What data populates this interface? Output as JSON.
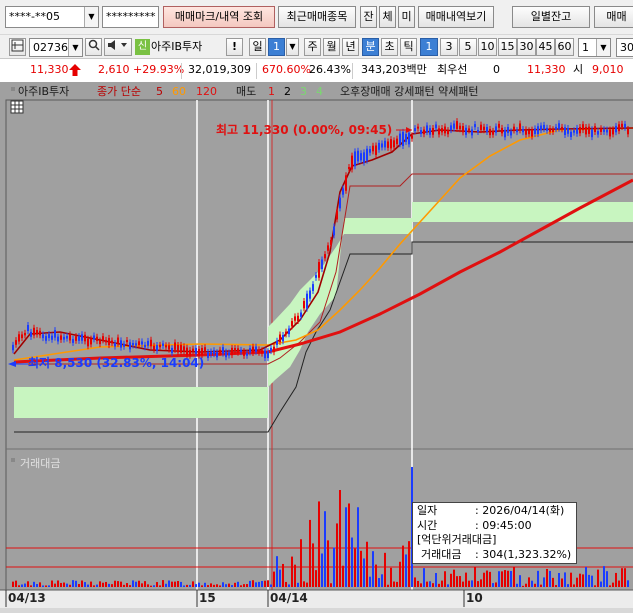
{
  "toolbar": {
    "account": "****-**05",
    "password": "*********",
    "trade_mark_button": "매매마크/내역 조회",
    "recent_trades_button": "최근매매종목",
    "balance_button": "잔",
    "fill_button": "체",
    "unfilled_button": "미",
    "history_view_button": "매매내역보기",
    "daily_balance_button": "일별잔고",
    "trade_button": "매매"
  },
  "stock_bar": {
    "code": "027360",
    "credit_badge": "신",
    "name": "아주IB투자",
    "warn_button": "!",
    "period_label": "일",
    "period_value": "1",
    "period_tabs": [
      "주",
      "월",
      "년"
    ],
    "minute_tab": "분",
    "tick_tab": "초",
    "extra_tab": "틱",
    "intervals": [
      "1",
      "3",
      "5",
      "10",
      "15",
      "30",
      "45",
      "60"
    ],
    "count_value": "1",
    "right_value": "30"
  },
  "quote": {
    "price": "11,330",
    "change": "2,610",
    "change_rate": "+29.93%",
    "volume": "32,019,309",
    "volume_ratio": "670.60%",
    "turnover": "26.43%",
    "trade_amount": "343,203백만",
    "best_ask_label": "최우선",
    "best_ask_value": "0",
    "best_bid_value": "11,330",
    "open_label": "시",
    "open_value": "9,010"
  },
  "legend": {
    "name": "아주IB투자",
    "ma_label": "종가 단순",
    "ma5": "5",
    "ma60": "60",
    "ma120": "120",
    "sell_label": "매도",
    "sell_nums": [
      "1",
      "2",
      "3",
      "4"
    ],
    "pattern_text": "오후장매매 강세패턴 약세패턴"
  },
  "annotations": {
    "high": "최고 11,330 (0.00%, 09:45)",
    "low": "최저 8,530 (32.83%, 14:04)",
    "volume_panel": "거래대금"
  },
  "tooltip": {
    "date_label": "일자",
    "date_value": ": 2026/04/14(화)",
    "time_label": "시간",
    "time_value": ": 09:45:00",
    "section": "[억단위거래대금]",
    "amount_label": "거래대금",
    "amount_value": ": 304(1,323.32%)"
  },
  "xaxis": {
    "labels": [
      "04/13",
      "15",
      "04/14",
      "10"
    ]
  },
  "colors": {
    "up": "#e60000",
    "down": "#1a3cff",
    "ma5": "#b80000",
    "ma60": "#ff9900",
    "ma120": "#e01010",
    "cloud": "#c8f5c0",
    "chart_bg": "#a0a0a0"
  },
  "chart_data": {
    "type": "candlestick",
    "price_range": [
      8530,
      11330
    ],
    "high": 11330,
    "low": 8530,
    "volume_tooltip_value": 304
  }
}
